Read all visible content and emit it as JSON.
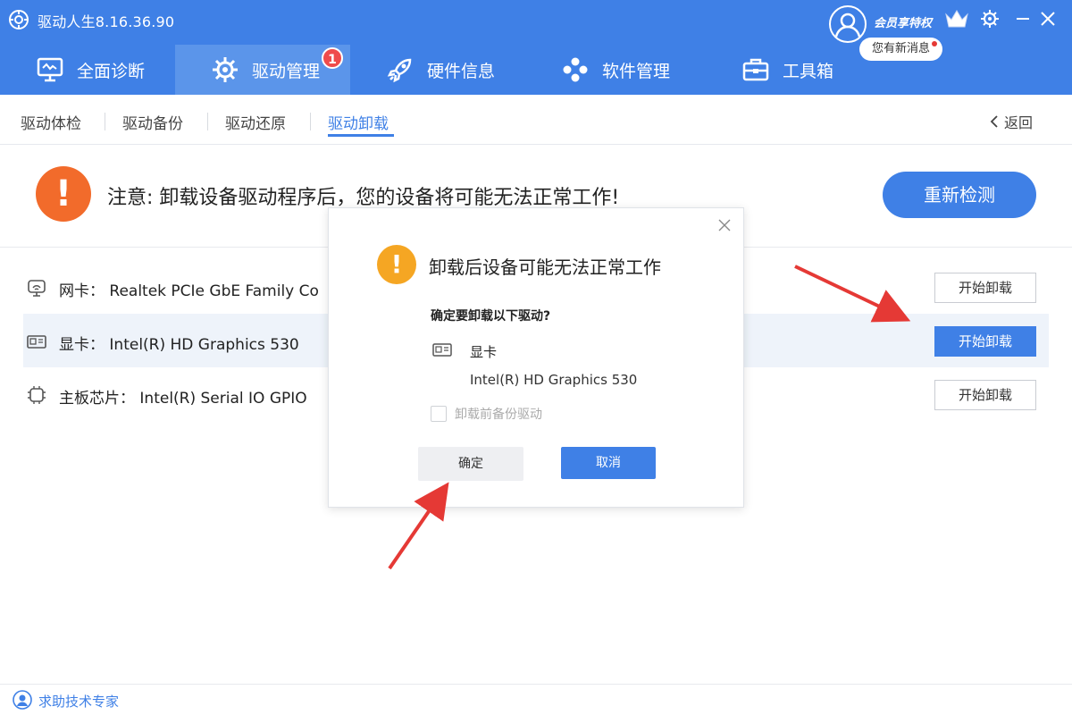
{
  "app": {
    "title": "驱动人生8.16.36.90",
    "vip_label": "会员享特权",
    "message_bubble": "您有新消息"
  },
  "main_tabs": [
    {
      "label": "全面诊断",
      "icon": "monitor-icon"
    },
    {
      "label": "驱动管理",
      "icon": "gear-icon",
      "active": true,
      "badge": "1"
    },
    {
      "label": "硬件信息",
      "icon": "rocket-icon"
    },
    {
      "label": "软件管理",
      "icon": "apps-icon"
    },
    {
      "label": "工具箱",
      "icon": "toolbox-icon"
    }
  ],
  "sub_tabs": [
    {
      "label": "驱动体检"
    },
    {
      "label": "驱动备份"
    },
    {
      "label": "驱动还原"
    },
    {
      "label": "驱动卸载",
      "active": true
    }
  ],
  "back_label": "返回",
  "warning": {
    "text": "注意: 卸载设备驱动程序后，您的设备将可能无法正常工作!",
    "recheck_label": "重新检测"
  },
  "drivers": [
    {
      "name": "网卡： Realtek PCIe GbE Family Co",
      "icon": "network-card-icon",
      "button": "开始卸载"
    },
    {
      "name": "显卡： Intel(R) HD Graphics 530",
      "icon": "graphics-card-icon",
      "button": "开始卸载",
      "selected": true
    },
    {
      "name": "主板芯片： Intel(R) Serial IO GPIO",
      "icon": "chipset-icon",
      "button": "开始卸载"
    }
  ],
  "dialog": {
    "title": "卸载后设备可能无法正常工作",
    "question": "确定要卸载以下驱动?",
    "device_type": "显卡",
    "device_name": "Intel(R) HD Graphics 530",
    "backup_label": "卸载前备份驱动",
    "ok_label": "确定",
    "cancel_label": "取消"
  },
  "footer": {
    "help_label": "求助技术专家"
  },
  "colors": {
    "brand_blue": "#3f80e6",
    "warning_orange": "#f26b2b",
    "dialog_warning": "#f5a623",
    "annotation_red": "#e53935"
  }
}
